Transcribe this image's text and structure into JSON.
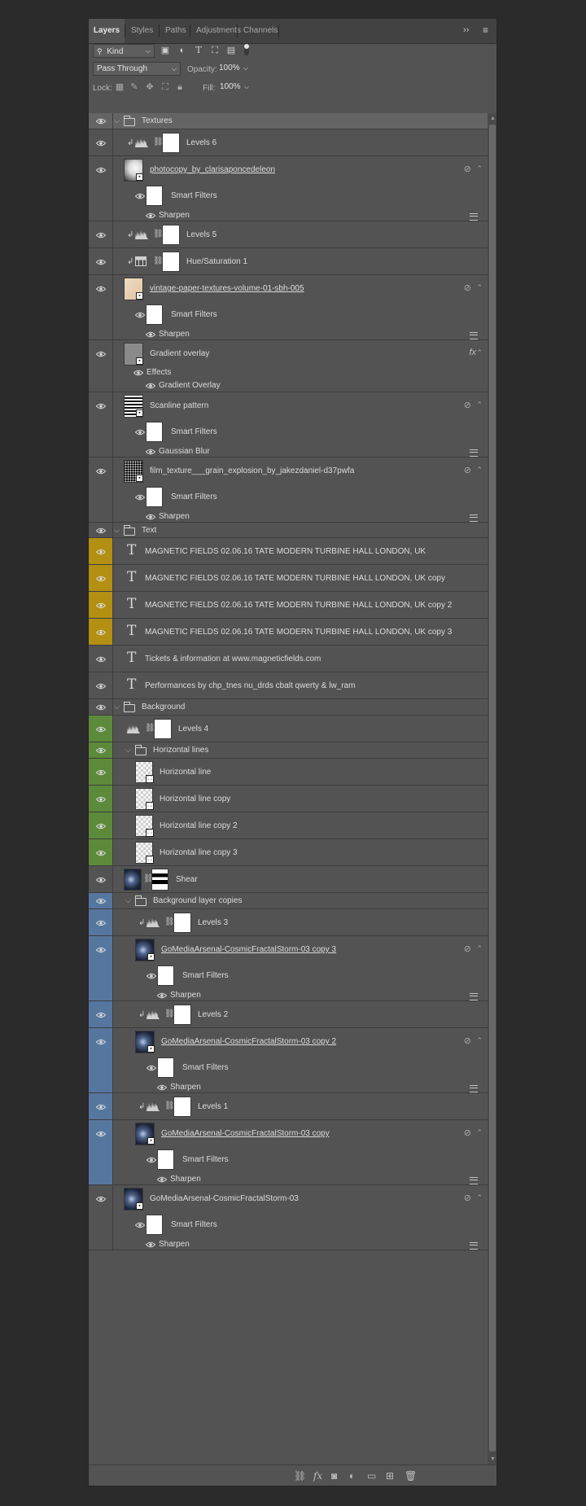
{
  "tabs": [
    "Layers",
    "Styles",
    "Paths",
    "Adjustments",
    "Channels"
  ],
  "filter": {
    "kind_label": "Kind"
  },
  "blend": {
    "mode": "Pass Through",
    "opacity_label": "Opacity:",
    "opacity_value": "100%",
    "fill_label": "Fill:",
    "fill_value": "100%",
    "lock_label": "Lock:"
  },
  "layers": {
    "textures_group": "Textures",
    "levels6": "Levels 6",
    "photocopy": "photocopy_by_clarisaponcedeleon",
    "smart_filters": "Smart Filters",
    "sharpen": "Sharpen",
    "levels5": "Levels 5",
    "huesat": "Hue/Saturation 1",
    "vintage": "vintage-paper-textures-volume-01-sbh-005",
    "gradient_overlay_layer": "Gradient overlay",
    "effects": "Effects",
    "gradient_overlay_effect": "Gradient Overlay",
    "scanline": "Scanline pattern",
    "gaussian": "Gaussian Blur",
    "film": "film_texture___grain_explosion_by_jakezdaniel-d37pwfa",
    "text_group": "Text",
    "mf1": "MAGNETIC FIELDS 02.06.16 TATE MODERN TURBINE HALL LONDON, UK",
    "mf2": "MAGNETIC FIELDS 02.06.16 TATE MODERN TURBINE HALL LONDON, UK copy",
    "mf3": "MAGNETIC FIELDS 02.06.16 TATE MODERN TURBINE HALL LONDON, UK copy 2",
    "mf4": "MAGNETIC FIELDS 02.06.16 TATE MODERN TURBINE HALL LONDON, UK copy 3",
    "tickets": "Tickets & information at www.magneticfields.com",
    "performances": "Performances by  chp_tnes nu_drds cbalt qwerty & lw_ram",
    "background_group": "Background",
    "levels4": "Levels 4",
    "horiz_group": "Horizontal lines",
    "hl1": "Horizontal line",
    "hl2": "Horizontal line copy",
    "hl3": "Horizontal line copy 2",
    "hl4": "Horizontal line copy 3",
    "shear": "Shear",
    "bgcopies_group": "Background layer copies",
    "levels3": "Levels 3",
    "gm3": "GoMediaArsenal-CosmicFractalStorm-03 copy 3",
    "levels2": "Levels 2",
    "gm2": "GoMediaArsenal-CosmicFractalStorm-03 copy 2",
    "levels1": "Levels 1",
    "gm1": "GoMediaArsenal-CosmicFractalStorm-03 copy",
    "gm0": "GoMediaArsenal-CosmicFractalStorm-03"
  },
  "colors": {
    "yellow": "#b38f12",
    "green": "#5c8a3a",
    "blue": "#55769f"
  }
}
